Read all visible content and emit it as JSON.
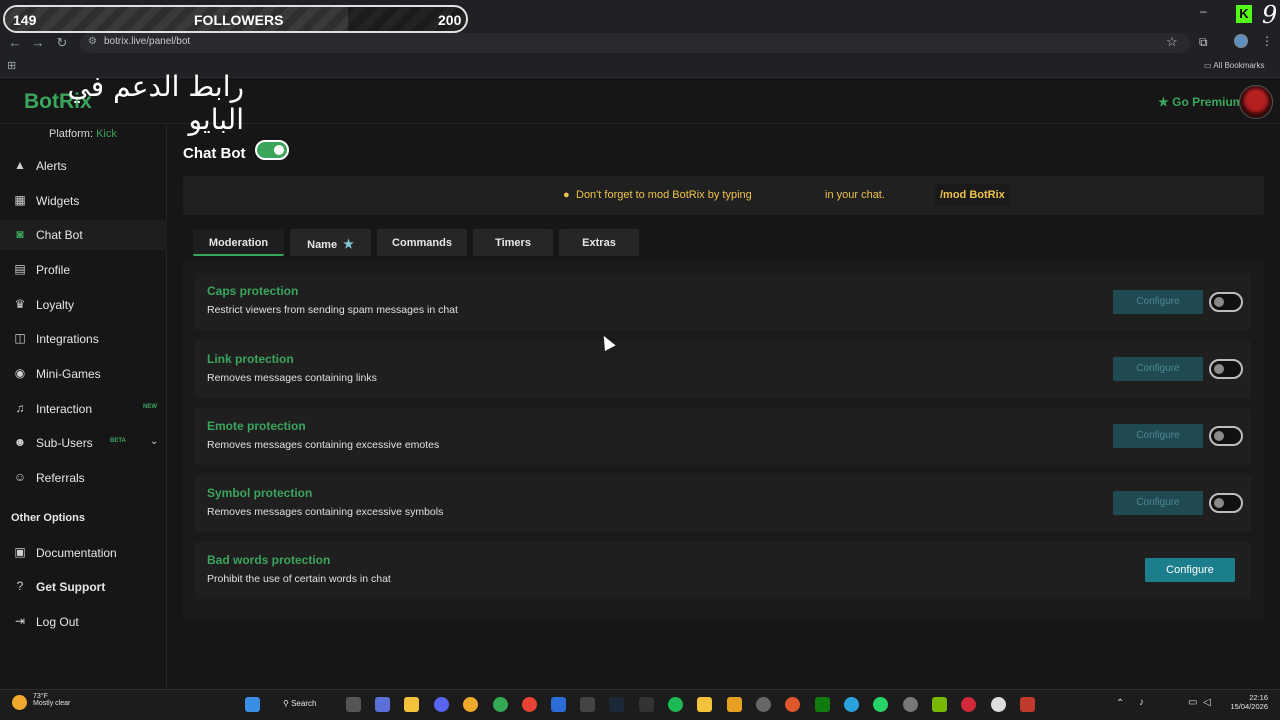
{
  "overlay": {
    "followers_current": "149",
    "followers_label": "FOLLOWERS",
    "followers_goal": "200",
    "progress": 0.745
  },
  "browser": {
    "url": "botrix.live/panel/bot",
    "bookmarks": "All Bookmarks"
  },
  "app": {
    "logo": "BotRix",
    "arabic_caption": "رابط الدعم في البايو",
    "go_premium": "Go Premium",
    "platform_label": "Platform:",
    "platform_value": "Kick"
  },
  "sidebar": {
    "items": [
      {
        "label": "Alerts",
        "icon": "warning-icon"
      },
      {
        "label": "Widgets",
        "icon": "grid-icon"
      },
      {
        "label": "Chat Bot",
        "icon": "robot-icon",
        "active": true
      },
      {
        "label": "Profile",
        "icon": "profile-icon"
      },
      {
        "label": "Loyalty",
        "icon": "trophy-icon"
      },
      {
        "label": "Integrations",
        "icon": "integrations-icon"
      },
      {
        "label": "Mini-Games",
        "icon": "gamepad-icon"
      },
      {
        "label": "Interaction",
        "icon": "music-icon",
        "badge": "NEW"
      },
      {
        "label": "Sub-Users",
        "icon": "users-icon",
        "badge": "BETA"
      },
      {
        "label": "Referrals",
        "icon": "referrals-icon"
      }
    ],
    "other_title": "Other Options",
    "other_items": [
      {
        "label": "Documentation",
        "icon": "document-icon"
      },
      {
        "label": "Get Support",
        "icon": "help-icon"
      },
      {
        "label": "Log Out",
        "icon": "logout-icon"
      }
    ]
  },
  "main": {
    "title": "Chat Bot",
    "bot_enabled": true,
    "notice_prefix": "Don't forget to mod BotRix by typing",
    "notice_command": "/mod BotRix",
    "notice_suffix": "in your chat.",
    "tabs": [
      "Moderation",
      "Name",
      "Commands",
      "Timers",
      "Extras"
    ],
    "active_tab": "Moderation",
    "cards": [
      {
        "title": "Caps protection",
        "desc": "Restrict viewers from sending spam messages in chat",
        "button": "Configure",
        "enabled": false
      },
      {
        "title": "Link protection",
        "desc": "Removes messages containing links",
        "button": "Configure",
        "enabled": false
      },
      {
        "title": "Emote protection",
        "desc": "Removes messages containing excessive emotes",
        "button": "Configure",
        "enabled": false
      },
      {
        "title": "Symbol protection",
        "desc": "Removes messages containing excessive symbols",
        "button": "Configure",
        "enabled": false
      },
      {
        "title": "Bad words protection",
        "desc": "Prohibit the use of certain words in chat",
        "button": "Configure",
        "enabled": true
      }
    ]
  },
  "taskbar": {
    "temp": "73°F",
    "weather": "Mostly clear",
    "search": "Search",
    "time": "22:16",
    "date": "15/04/2026"
  },
  "colors": {
    "accent": "#3ba55c",
    "button": "#1c7e8c",
    "notice": "#f0c24b"
  }
}
